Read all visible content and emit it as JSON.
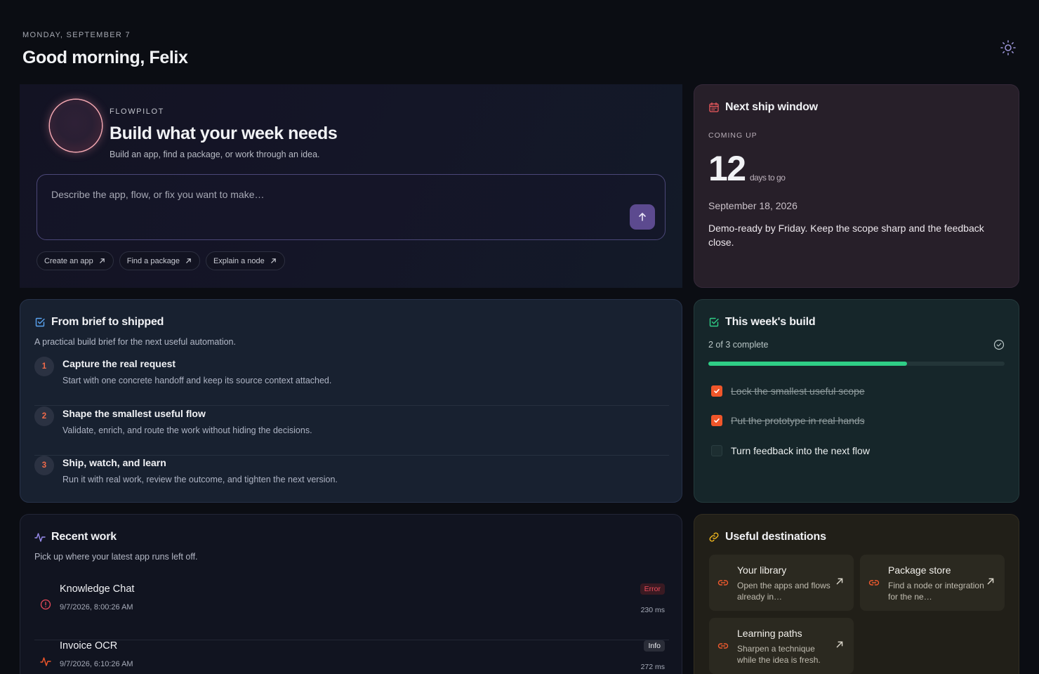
{
  "header": {
    "date": "MONDAY, SEPTEMBER 7",
    "greeting": "Good morning, Felix"
  },
  "hero": {
    "brand": "FLOWPILOT",
    "title": "Build what your week needs",
    "subtitle": "Build an app, find a package, or work through an idea.",
    "prompt_placeholder": "Describe the app, flow, or fix you want to make…",
    "chips": [
      "Create an app",
      "Find a package",
      "Explain a node"
    ]
  },
  "ship": {
    "title": "Next ship window",
    "label": "COMING UP",
    "days": "12",
    "unit": "days to go",
    "date": "September 18, 2026",
    "note": "Demo-ready by Friday. Keep the scope sharp and the feedback close."
  },
  "brief": {
    "title": "From brief to shipped",
    "subtitle": "A practical build brief for the next useful automation.",
    "steps": [
      {
        "num": "1",
        "title": "Capture the real request",
        "desc": "Start with one concrete handoff and keep its source context attached."
      },
      {
        "num": "2",
        "title": "Shape the smallest useful flow",
        "desc": "Validate, enrich, and route the work without hiding the decisions."
      },
      {
        "num": "3",
        "title": "Ship, watch, and learn",
        "desc": "Run it with real work, review the outcome, and tighten the next version."
      }
    ]
  },
  "week": {
    "title": "This week's build",
    "count": "2 of 3 complete",
    "progress": 0.67,
    "tasks": [
      {
        "label": "Lock the smallest useful scope",
        "done": true
      },
      {
        "label": "Put the prototype in real hands",
        "done": true
      },
      {
        "label": "Turn feedback into the next flow",
        "done": false
      }
    ]
  },
  "recent": {
    "title": "Recent work",
    "subtitle": "Pick up where your latest app runs left off.",
    "runs": [
      {
        "name": "Knowledge Chat",
        "time": "9/7/2026, 8:00:26 AM",
        "status": "Error",
        "duration": "230 ms"
      },
      {
        "name": "Invoice OCR",
        "time": "9/7/2026, 6:10:26 AM",
        "status": "Info",
        "duration": "272 ms"
      }
    ]
  },
  "destinations": {
    "title": "Useful destinations",
    "tiles": [
      {
        "title": "Your library",
        "desc": "Open the apps and flows already in…"
      },
      {
        "title": "Package store",
        "desc": "Find a node or integration for the ne…"
      },
      {
        "title": "Learning paths",
        "desc": "Sharpen a technique while the idea is fresh."
      }
    ]
  },
  "colors": {
    "accent": "#5c4a8f",
    "progress": "#2fce86",
    "check": "#f0562a",
    "error": "#ea4a5a"
  }
}
